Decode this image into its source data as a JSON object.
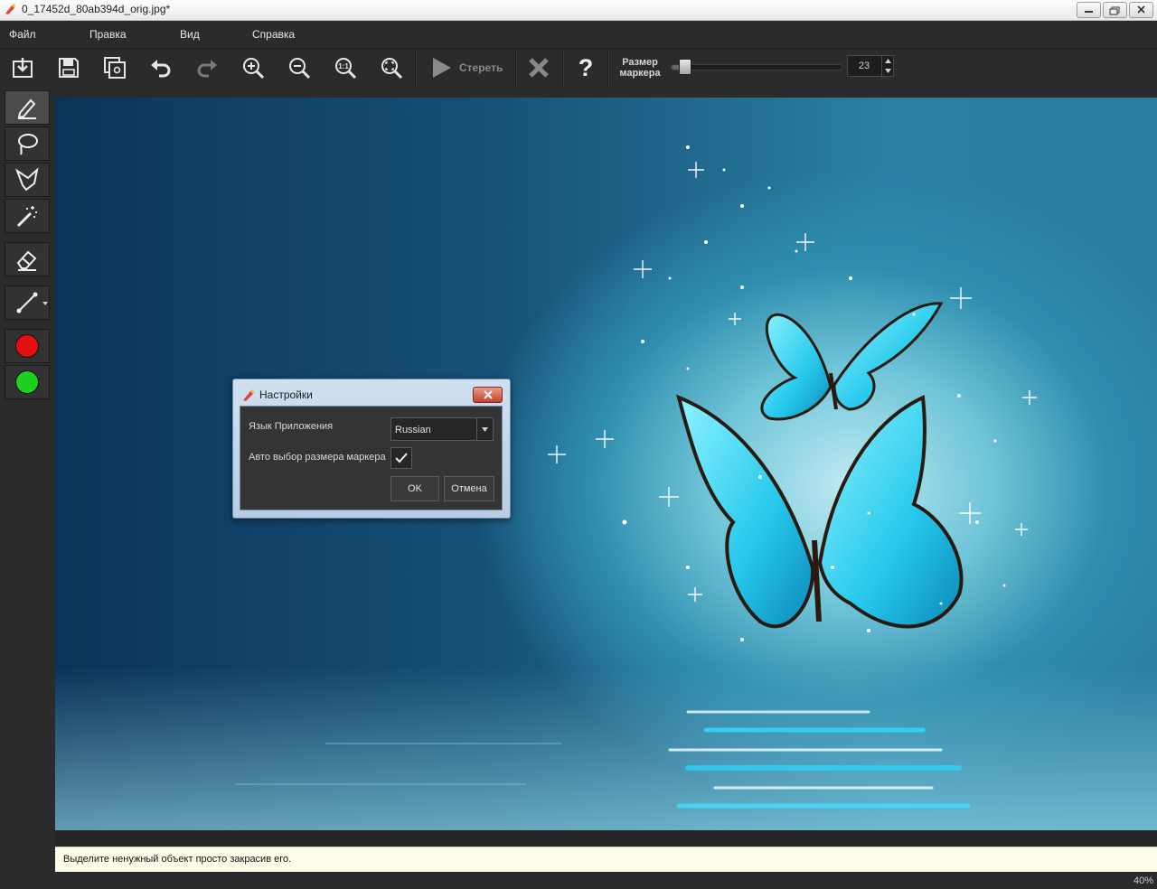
{
  "window": {
    "title": "0_17452d_80ab394d_orig.jpg*",
    "controls": [
      "minimize",
      "maximize",
      "close"
    ]
  },
  "menu": [
    "Файл",
    "Правка",
    "Вид",
    "Справка"
  ],
  "toolbar": {
    "buttons": [
      "open-icon",
      "save-icon",
      "save-as-icon",
      "undo-icon",
      "redo-icon",
      "zoom-in-icon",
      "zoom-out-icon",
      "zoom-actual-icon",
      "zoom-fit-icon"
    ],
    "erase_label": "Стереть",
    "cancel": "x-icon",
    "help": "?",
    "marker_size_label_1": "Размер",
    "marker_size_label_2": "маркера",
    "marker_size_value": "23",
    "marker_size_fraction": 0.05
  },
  "tools": [
    "marker-pen-icon",
    "lasso-icon",
    "polygon-lasso-icon",
    "magic-wand-icon",
    "eraser-icon",
    "line-icon"
  ],
  "colors": {
    "red": "#e31010",
    "green": "#1ed11e"
  },
  "dialog": {
    "title": "Настройки",
    "language_label": "Язык Приложения",
    "language_value": "Russian",
    "auto_marker_label": "Авто выбор размера маркера",
    "auto_marker_checked": true,
    "ok_label": "OK",
    "cancel_label": "Отмена"
  },
  "status": {
    "message": "Выделите ненужный объект просто закрасив его.",
    "zoom": "40%"
  }
}
